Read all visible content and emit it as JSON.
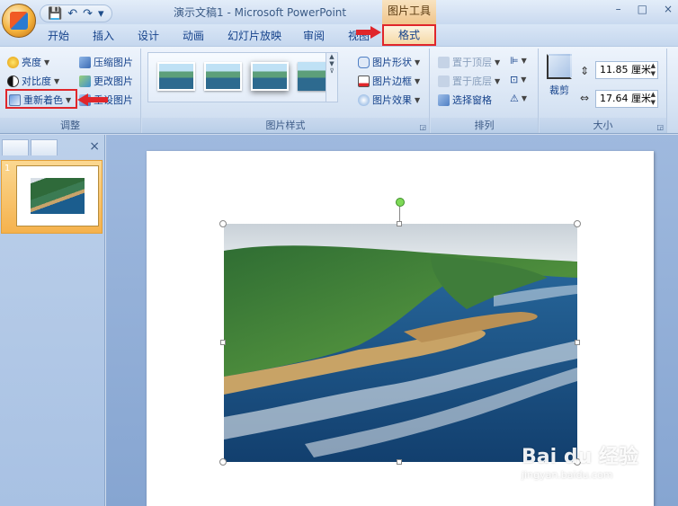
{
  "titlebar": {
    "title": "演示文稿1 - Microsoft PowerPoint",
    "context_tab_title": "图片工具",
    "qat": [
      "💾",
      "↶",
      "↷",
      "▾"
    ]
  },
  "tabs": [
    {
      "label": "开始"
    },
    {
      "label": "插入"
    },
    {
      "label": "设计"
    },
    {
      "label": "动画"
    },
    {
      "label": "幻灯片放映"
    },
    {
      "label": "审阅"
    },
    {
      "label": "视图"
    },
    {
      "label": "格式",
      "active": true
    }
  ],
  "ribbon": {
    "adjust": {
      "label": "调整",
      "brightness": "亮度",
      "contrast": "对比度",
      "recolor": "重新着色",
      "compress": "压缩图片",
      "change": "更改图片",
      "reset": "重设图片"
    },
    "picture_styles": {
      "label": "图片样式",
      "shape": "图片形状",
      "border": "图片边框",
      "effects": "图片效果"
    },
    "arrange": {
      "label": "排列",
      "bring_front": "置于顶层",
      "send_back": "置于底层",
      "selection_pane": "选择窗格"
    },
    "size": {
      "label": "大小",
      "crop": "裁剪",
      "height": "11.85 厘米",
      "width": "17.64 厘米"
    }
  },
  "slides_panel": {
    "slide_number": "1"
  },
  "watermark": {
    "logo": "Bai du 经验",
    "url": "jingyan.baidu.com"
  }
}
